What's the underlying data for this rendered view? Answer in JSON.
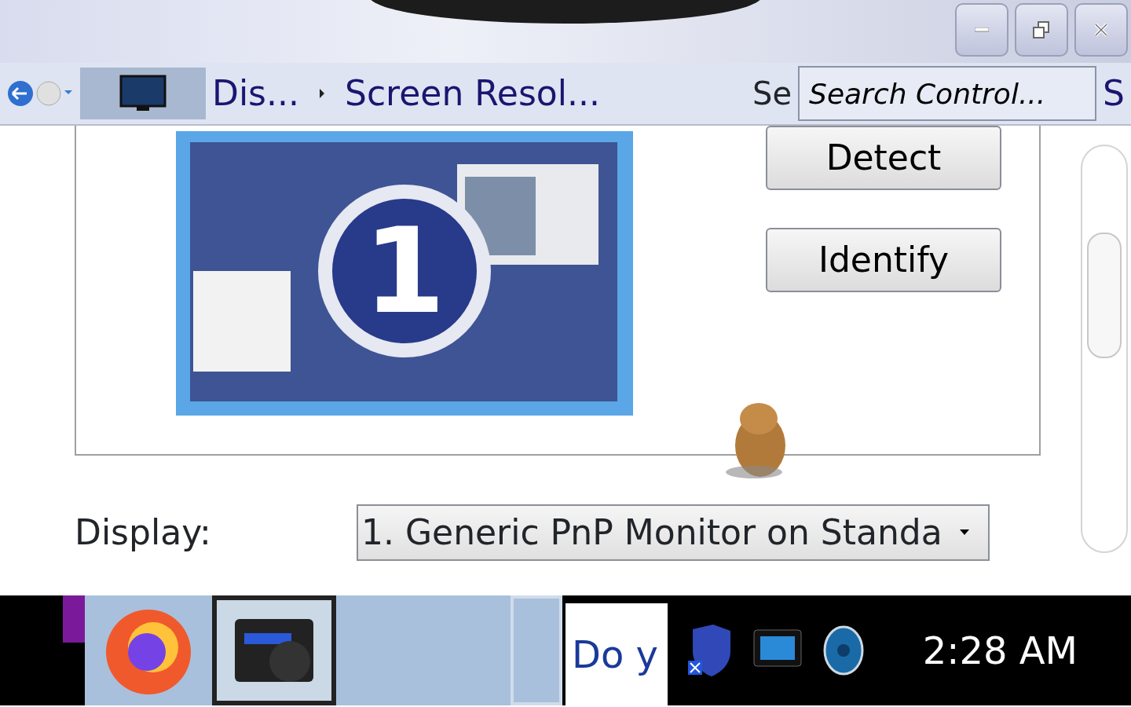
{
  "address_bar": {
    "breadcrumb": [
      {
        "label": "Dis..."
      },
      {
        "label": "Screen Resol..."
      }
    ],
    "overlay_text": "Se"
  },
  "search": {
    "placeholder": "Search Control...",
    "tail_text": "S"
  },
  "monitor_preview": {
    "number": "1"
  },
  "buttons": [
    "Detect",
    "Identify"
  ],
  "display": {
    "label": "Display:",
    "value": "1. Generic PnP Monitor on Standa"
  },
  "taskbar": {
    "preview_text": "Do y",
    "clock": "2:28 AM"
  }
}
